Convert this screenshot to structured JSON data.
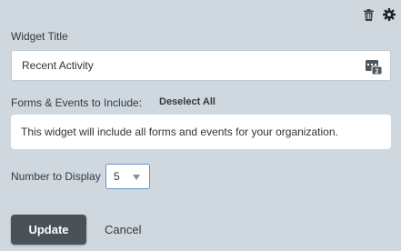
{
  "header": {
    "delete_icon": "trash-icon",
    "settings_icon": "gear-icon"
  },
  "widget_title": {
    "label": "Widget Title",
    "value": "Recent Activity",
    "insert_icon": "insert-field-icon"
  },
  "forms_events": {
    "label": "Forms & Events to Include:",
    "deselect_label": "Deselect All",
    "info_text": "This widget will include all forms and events for your organization."
  },
  "number_to_display": {
    "label": "Number to Display",
    "selected_value": "5"
  },
  "actions": {
    "update_label": "Update",
    "cancel_label": "Cancel"
  },
  "colors": {
    "background": "#cfd8df",
    "update_button": "#4a5157",
    "select_border": "#6b93c8"
  }
}
